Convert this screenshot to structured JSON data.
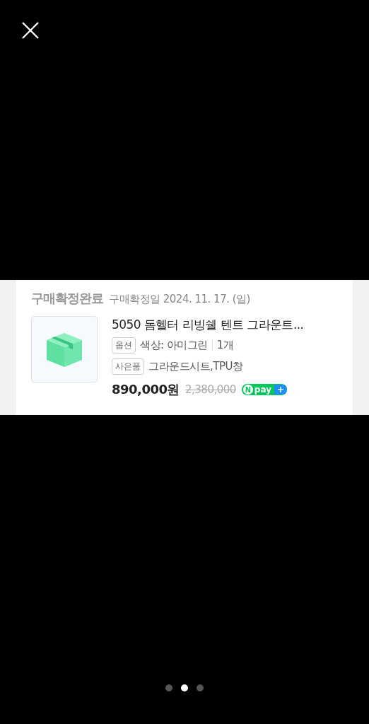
{
  "order": {
    "status": "구매확정완료",
    "confirm_date": "구매확정일 2024. 11. 17. (일)",
    "product": {
      "title": "5050 돔헬터 리빙쉘 텐트 그라운트...",
      "option": {
        "tag": "옵션",
        "value": "색상: 아미그린",
        "quantity": "1개"
      },
      "gift": {
        "tag": "사은품",
        "value": "그라운드시트,TPU창"
      },
      "price": "890,000원",
      "original_price": "2,380,000",
      "badge": {
        "mark": "N",
        "text": "pay",
        "plus": "+"
      }
    }
  },
  "pages": [
    {
      "selected": false
    },
    {
      "selected": true
    },
    {
      "selected": false
    }
  ]
}
